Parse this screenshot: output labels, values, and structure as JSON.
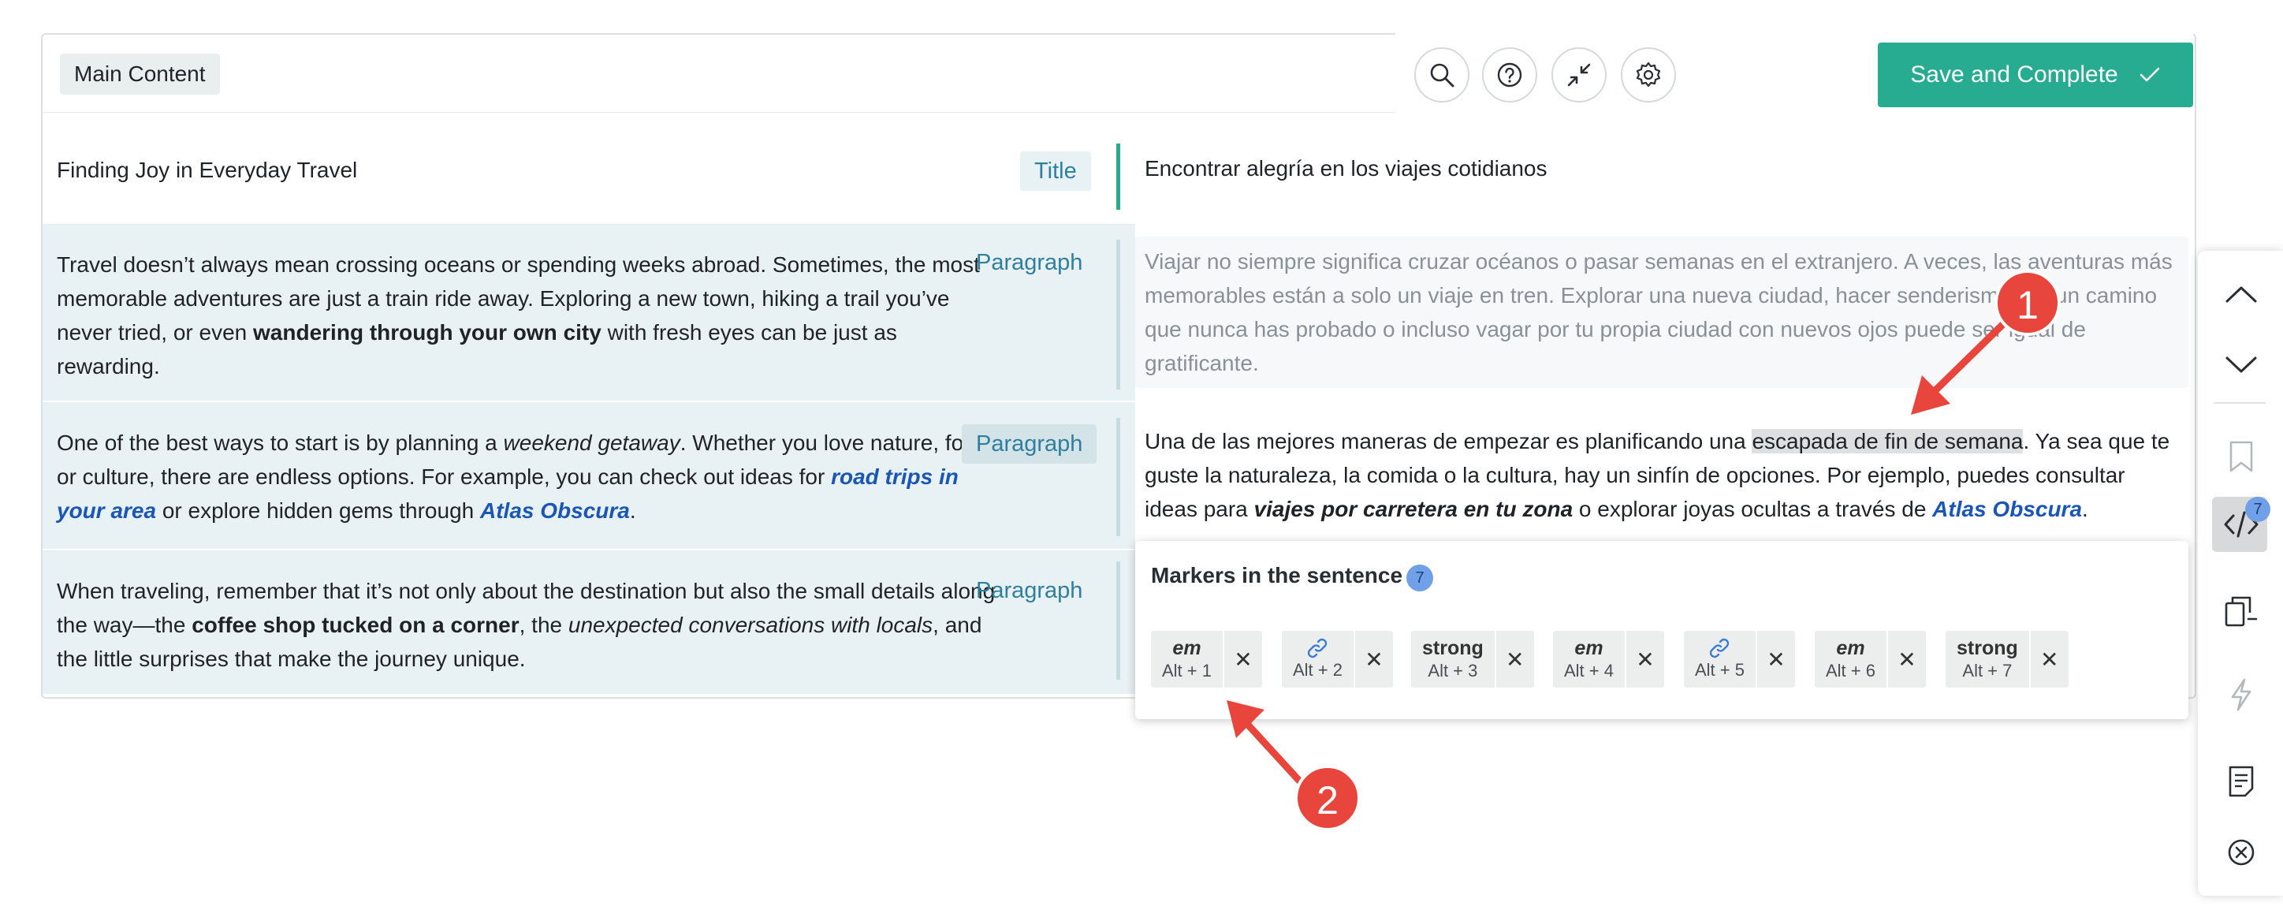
{
  "header": {
    "tag": "Main Content",
    "icons": [
      "search-icon",
      "help-icon",
      "collapse-icon",
      "settings-icon"
    ],
    "save_label": "Save and Complete"
  },
  "rows": [
    {
      "type": "Title",
      "source": "Finding Joy in Everyday Travel",
      "target": "Encontrar alegría en los viajes cotidianos"
    },
    {
      "type": "Paragraph",
      "source": {
        "t1": "Travel doesn’t always mean crossing oceans or spending weeks abroad. Sometimes, the most memorable adventures are just a train ride away. Exploring a new town, hiking a trail you’ve never tried, or even ",
        "b1": "wandering through your own city",
        "t2": " with fresh eyes can be just as rewarding."
      },
      "target": "Viajar no siempre significa cruzar océanos o pasar semanas en el extranjero. A veces, las aventuras más memorables están a solo un viaje en tren. Explorar una nueva ciudad, hacer senderismo por un camino que nunca has probado o incluso vagar por tu propia ciudad con nuevos ojos puede ser igual de gratificante."
    },
    {
      "type": "Paragraph",
      "source": {
        "t1": "One of the best ways to start is by planning a ",
        "i1": "weekend getaway",
        "t2": ". Whether you love nature, food, or culture, there are endless options. For example, you can check out ideas for ",
        "l1": "road trips in your area",
        "t3": " or explore hidden gems through ",
        "l2": "Atlas Obscura",
        "t4": "."
      },
      "target": {
        "t1": "Una de las mejores maneras de empezar es planificando una ",
        "h1": "escapada de fin de semana",
        "t2": ". Ya sea que te guste la naturaleza, la comida o la cultura, hay un sinfín de opciones. Por ejemplo, puedes consultar ideas para ",
        "b1": "viajes por carretera en tu zona",
        "t3": " o explorar joyas ocultas a través de ",
        "l1": "Atlas Obscura",
        "t4": "."
      }
    },
    {
      "type": "Paragraph",
      "source": {
        "t1": "When traveling, remember that it’s not only about the destination but also the small details along the way—the ",
        "b1": "coffee shop tucked on a corner",
        "t2": ", the ",
        "i1": "unexpected conversations with locals",
        "t3": ", and the little surprises that make the journey unique."
      }
    }
  ],
  "markers_popup": {
    "title": "Markers in the sentence",
    "count": "7",
    "markers": [
      {
        "tag": "em",
        "shortcut": "Alt + 1"
      },
      {
        "tag": "link-icon",
        "shortcut": "Alt + 2"
      },
      {
        "tag": "strong",
        "shortcut": "Alt + 3"
      },
      {
        "tag": "em",
        "shortcut": "Alt + 4"
      },
      {
        "tag": "link-icon",
        "shortcut": "Alt + 5"
      },
      {
        "tag": "em",
        "shortcut": "Alt + 6"
      },
      {
        "tag": "strong",
        "shortcut": "Alt + 7"
      }
    ]
  },
  "right_toolbar": {
    "icons": [
      "chevron-up-icon",
      "chevron-down-icon",
      "bookmark-icon",
      "code-markers-icon",
      "copy-source-icon",
      "lightning-icon",
      "notes-icon",
      "close-circle-icon"
    ],
    "markers_count": "7"
  },
  "annotations": {
    "callout_1": "1",
    "callout_2": "2",
    "color": "#e8453c"
  },
  "colors": {
    "accent": "#27ab91",
    "row_bg": "#e8f1f4",
    "badge_text": "#2f7f9e",
    "link": "#1a56b5",
    "badge_count": "#6fa0e8"
  }
}
